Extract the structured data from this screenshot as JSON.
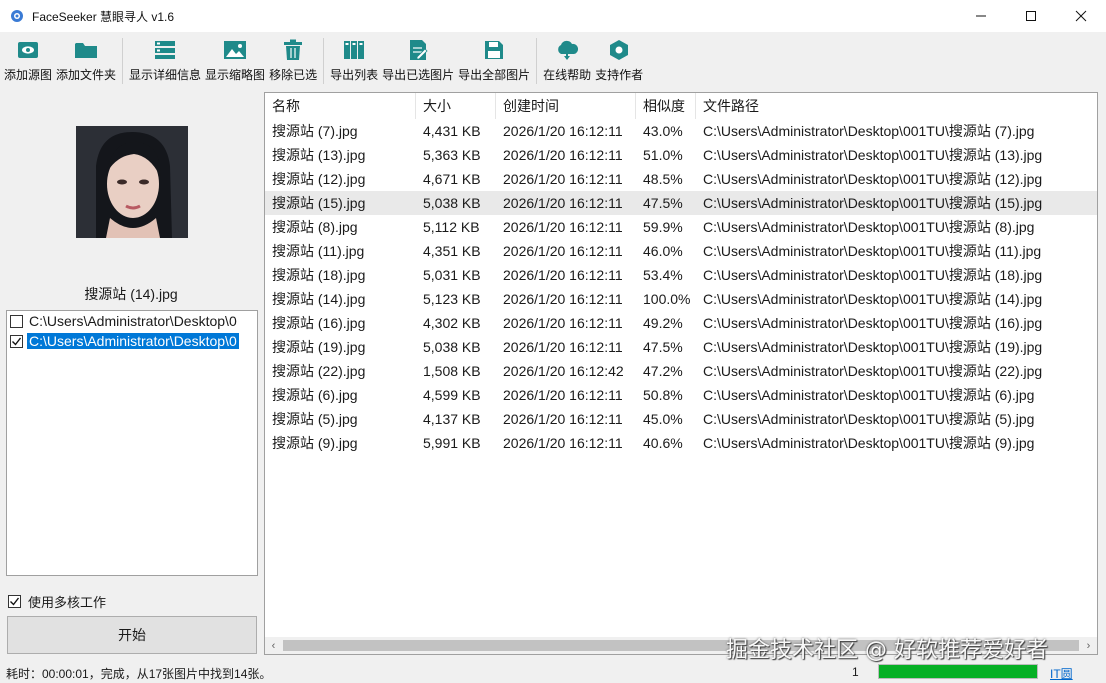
{
  "window": {
    "title": "FaceSeeker 慧眼寻人 v1.6"
  },
  "toolbar": [
    {
      "label": "添加源图",
      "icon": "eye-icon"
    },
    {
      "label": "添加文件夹",
      "icon": "folder-icon"
    },
    {
      "label": "显示详细信息",
      "icon": "details-list-icon"
    },
    {
      "label": "显示缩略图",
      "icon": "image-icon"
    },
    {
      "label": "移除已选",
      "icon": "trash-icon"
    },
    {
      "label": "导出列表",
      "icon": "export-list-icon"
    },
    {
      "label": "导出已选图片",
      "icon": "export-selected-icon"
    },
    {
      "label": "导出全部图片",
      "icon": "save-icon"
    },
    {
      "label": "在线帮助",
      "icon": "cloud-icon"
    },
    {
      "label": "支持作者",
      "icon": "hexagon-icon"
    }
  ],
  "source": {
    "preview_name": "搜源站 (14).jpg"
  },
  "folders": [
    {
      "path": "C:\\Users\\Administrator\\Desktop\\0",
      "checked": false,
      "selected": false
    },
    {
      "path": "C:\\Users\\Administrator\\Desktop\\0",
      "checked": true,
      "selected": true
    }
  ],
  "options": {
    "multicore_label": "使用多核工作",
    "multicore_checked": true,
    "start_label": "开始"
  },
  "results": {
    "columns": [
      "名称",
      "大小",
      "创建时间",
      "相似度",
      "文件路径"
    ],
    "rows": [
      [
        "搜源站 (7).jpg",
        "4,431 KB",
        "2026/1/20 16:12:11",
        "43.0%",
        "C:\\Users\\Administrator\\Desktop\\001TU\\搜源站 (7).jpg"
      ],
      [
        "搜源站 (13).jpg",
        "5,363 KB",
        "2026/1/20 16:12:11",
        "51.0%",
        "C:\\Users\\Administrator\\Desktop\\001TU\\搜源站 (13).jpg"
      ],
      [
        "搜源站 (12).jpg",
        "4,671 KB",
        "2026/1/20 16:12:11",
        "48.5%",
        "C:\\Users\\Administrator\\Desktop\\001TU\\搜源站 (12).jpg"
      ],
      [
        "搜源站 (15).jpg",
        "5,038 KB",
        "2026/1/20 16:12:11",
        "47.5%",
        "C:\\Users\\Administrator\\Desktop\\001TU\\搜源站 (15).jpg"
      ],
      [
        "搜源站 (8).jpg",
        "5,112 KB",
        "2026/1/20 16:12:11",
        "59.9%",
        "C:\\Users\\Administrator\\Desktop\\001TU\\搜源站 (8).jpg"
      ],
      [
        "搜源站 (11).jpg",
        "4,351 KB",
        "2026/1/20 16:12:11",
        "46.0%",
        "C:\\Users\\Administrator\\Desktop\\001TU\\搜源站 (11).jpg"
      ],
      [
        "搜源站 (18).jpg",
        "5,031 KB",
        "2026/1/20 16:12:11",
        "53.4%",
        "C:\\Users\\Administrator\\Desktop\\001TU\\搜源站 (18).jpg"
      ],
      [
        "搜源站 (14).jpg",
        "5,123 KB",
        "2026/1/20 16:12:11",
        "100.0%",
        "C:\\Users\\Administrator\\Desktop\\001TU\\搜源站 (14).jpg"
      ],
      [
        "搜源站 (16).jpg",
        "4,302 KB",
        "2026/1/20 16:12:11",
        "49.2%",
        "C:\\Users\\Administrator\\Desktop\\001TU\\搜源站 (16).jpg"
      ],
      [
        "搜源站 (19).jpg",
        "5,038 KB",
        "2026/1/20 16:12:11",
        "47.5%",
        "C:\\Users\\Administrator\\Desktop\\001TU\\搜源站 (19).jpg"
      ],
      [
        "搜源站 (22).jpg",
        "1,508 KB",
        "2026/1/20 16:12:42",
        "47.2%",
        "C:\\Users\\Administrator\\Desktop\\001TU\\搜源站 (22).jpg"
      ],
      [
        "搜源站 (6).jpg",
        "4,599 KB",
        "2026/1/20 16:12:11",
        "50.8%",
        "C:\\Users\\Administrator\\Desktop\\001TU\\搜源站 (6).jpg"
      ],
      [
        "搜源站 (5).jpg",
        "4,137 KB",
        "2026/1/20 16:12:11",
        "45.0%",
        "C:\\Users\\Administrator\\Desktop\\001TU\\搜源站 (5).jpg"
      ],
      [
        "搜源站 (9).jpg",
        "5,991 KB",
        "2026/1/20 16:12:11",
        "40.6%",
        "C:\\Users\\Administrator\\Desktop\\001TU\\搜源站 (9).jpg"
      ]
    ],
    "hover_row": 3
  },
  "status": {
    "text": "耗时：00:00:01，完成，从17张图片中找到14张。",
    "count": "1",
    "progress_percent": 100,
    "link": "IT圆"
  },
  "watermark": "掘金技术社区 @ 好软推荐爱好者",
  "colors": {
    "accent": "#0078d7",
    "toolbar_icon": "#1f8a8a",
    "progress": "#06b025"
  }
}
